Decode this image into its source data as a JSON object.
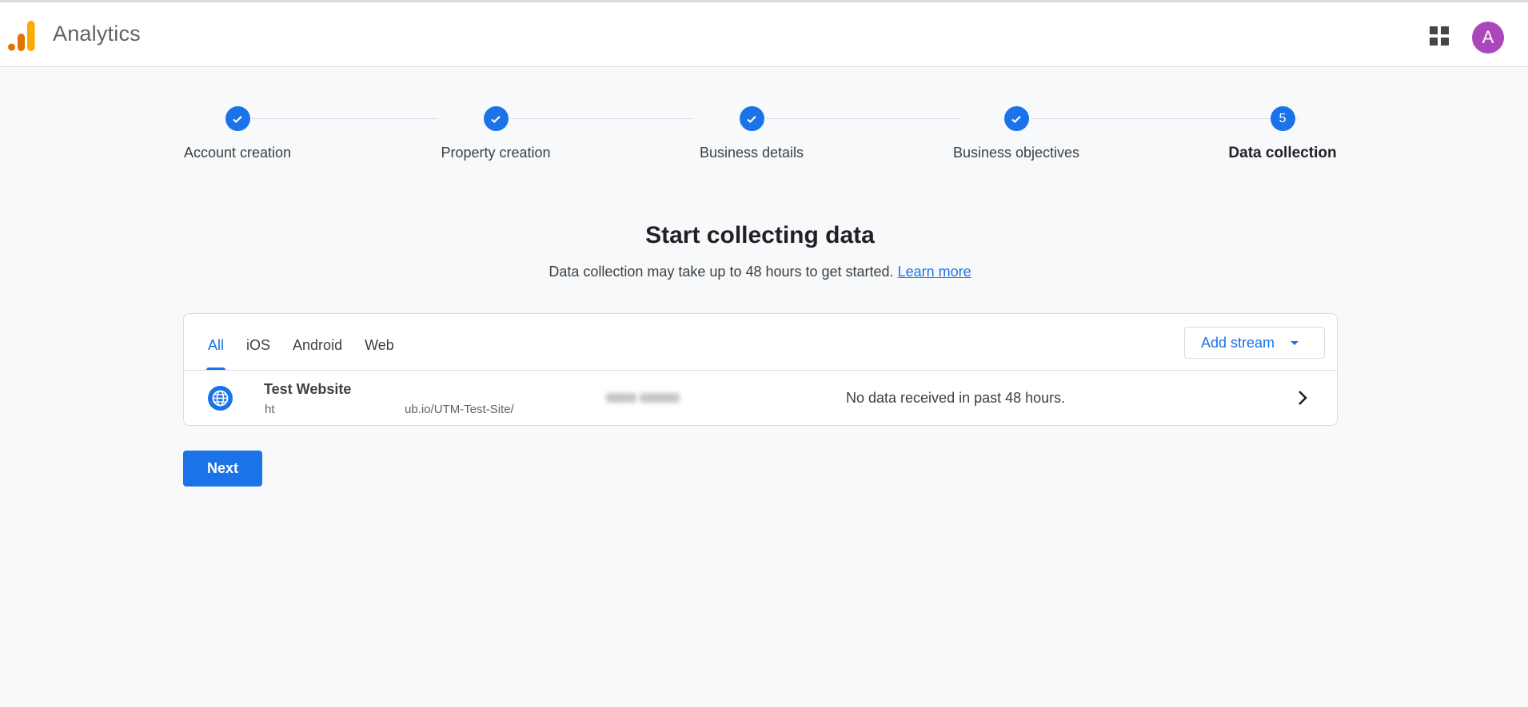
{
  "header": {
    "app_title": "Analytics",
    "logo_colors": {
      "dark": "#e37400",
      "light": "#f9ab00"
    },
    "apps_icon": "apps-grid-icon",
    "avatar_initial": "A",
    "avatar_color": "#ab47bc"
  },
  "stepper": {
    "steps": [
      {
        "label": "Account creation",
        "status": "complete",
        "icon": "check-icon"
      },
      {
        "label": "Property creation",
        "status": "complete",
        "icon": "check-icon"
      },
      {
        "label": "Business details",
        "status": "complete",
        "icon": "check-icon"
      },
      {
        "label": "Business objectives",
        "status": "complete",
        "icon": "check-icon"
      },
      {
        "label": "Data collection",
        "status": "active",
        "number": "5"
      }
    ],
    "accent": "#1a73e8"
  },
  "main": {
    "title": "Start collecting data",
    "subtitle": "Data collection may take up to 48 hours to get started.",
    "learn_more": "Learn more"
  },
  "streams": {
    "tabs": [
      {
        "label": "All",
        "active": true
      },
      {
        "label": "iOS",
        "active": false
      },
      {
        "label": "Android",
        "active": false
      },
      {
        "label": "Web",
        "active": false
      }
    ],
    "add_stream_label": "Add stream",
    "rows": [
      {
        "icon": "globe-icon",
        "name": "Test Website",
        "url_visible_start": "ht",
        "url_visible_end": "ub.io/UTM-Test-Site/",
        "status": "No data received in past 48 hours."
      }
    ]
  },
  "actions": {
    "next_label": "Next"
  }
}
